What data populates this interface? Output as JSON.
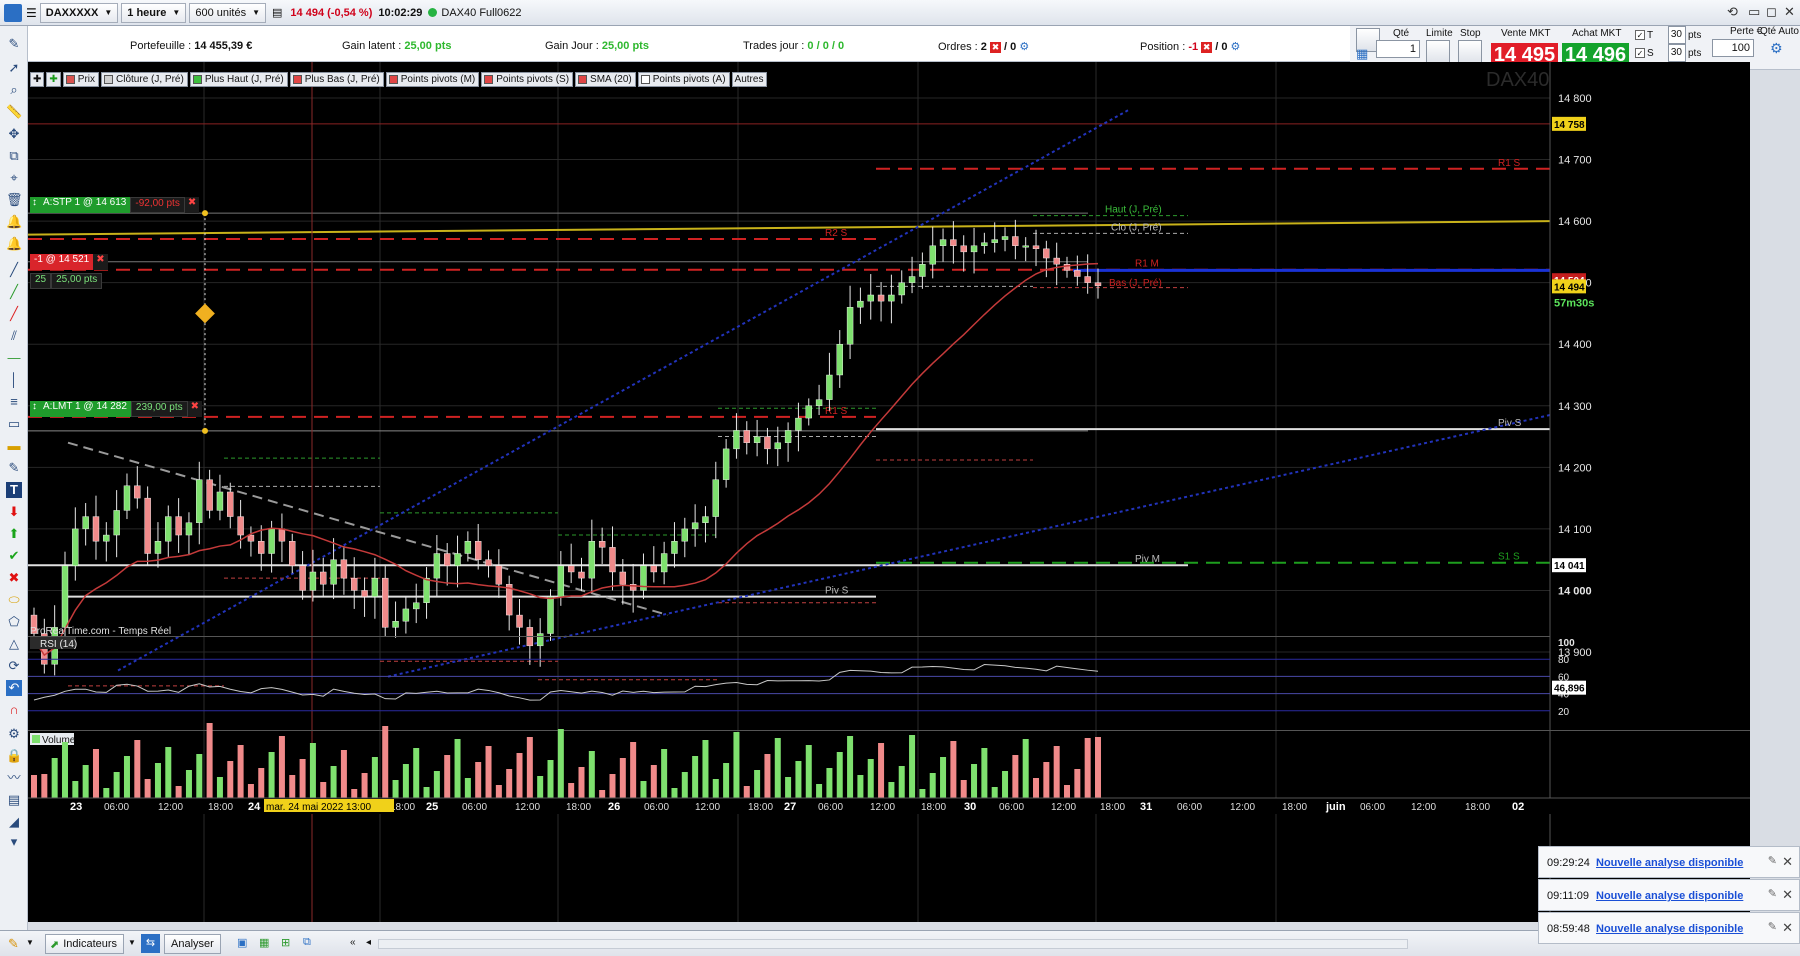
{
  "toolbar": {
    "instrument": "DAXXXXX",
    "timeframe": "1 heure",
    "units": "600 unités",
    "price": "14 494 (-0,54 %)",
    "time": "10:02:29",
    "instrument_name": "DAX40 Full0622"
  },
  "info": {
    "portefeuille_label": "Portefeuille :",
    "portefeuille_value": "14 455,39 €",
    "gain_latent_label": "Gain latent :",
    "gain_latent_value": "25,00 pts",
    "gain_jour_label": "Gain Jour :",
    "gain_jour_value": "25,00 pts",
    "trades_label": "Trades jour :",
    "trades_value": "0 / 0 / 0",
    "ordres_label": "Ordres :",
    "ordres_value": "2",
    "ordres_value2": "/ 0",
    "position_label": "Position :",
    "position_value": "-1",
    "position_value2": "/ 0"
  },
  "order": {
    "qte_label": "Qté",
    "qte_value": "1",
    "limite_label": "Limite",
    "stop_label": "Stop",
    "vente_label": "Vente MKT",
    "vente_price": "14 495",
    "achat_label": "Achat MKT",
    "achat_price": "14 496",
    "t_label": "T",
    "t_value": "30",
    "s_label": "S",
    "s_value": "30",
    "pts": "pts",
    "perte_label": "Perte €",
    "perte_value": "100",
    "qte_auto_label": "Qté Auto"
  },
  "legend": [
    {
      "label": "Prix",
      "color": "#d9534f"
    },
    {
      "label": "Clôture (J, Pré)",
      "color": "#cfcfcf"
    },
    {
      "label": "Plus Haut (J, Pré)",
      "color": "#3fbf3f"
    },
    {
      "label": "Plus Bas (J, Pré)",
      "color": "#e04646"
    },
    {
      "label": "Points pivots (M)",
      "color": "#e04646"
    },
    {
      "label": "Points pivots (S)",
      "color": "#e04646"
    },
    {
      "label": "SMA (20)",
      "color": "#e04646"
    },
    {
      "label": "Points pivots (A)",
      "color": "#ffffff"
    },
    {
      "label": "Autres",
      "color": ""
    }
  ],
  "chart": {
    "watermark": "DAX40 Full0622",
    "source": "ProRealTime.com - Temps Réel",
    "price_ticks": [
      "14 800",
      "14 700",
      "14 600",
      "14 500",
      "14 400",
      "14 300",
      "14 200",
      "14 100",
      "14 000",
      "13 900"
    ],
    "tag_14758": "14 758",
    "tag_14504": "14 504",
    "tag_14494": "14 494",
    "tag_timer": "57m30s",
    "tag_14041": "14 041",
    "orders": {
      "stp_label": "A:STP 1 @ 14 613",
      "stp_pts": "-92,00 pts",
      "pos_label": "-1 @ 14 521",
      "pos_qty": "25",
      "pos_pts": "25,00 pts",
      "lmt_label": "A:LMT 1 @ 14 282",
      "lmt_pts": "239,00 pts"
    },
    "levels": {
      "r2s": "R2 S",
      "r1s": "R1 S",
      "r1m": "R1 M",
      "r1s_top": "R1 S",
      "haut": "Haut (J, Pré)",
      "clo": "Clo (J, Pré)",
      "bas": "Bas (J, Pré)",
      "piv_s_right": "Piv S",
      "piv_s": "Piv S",
      "piv_m": "Piv M",
      "s1s": "S1 S"
    }
  },
  "rsi": {
    "label": "RSI (14)",
    "ticks": [
      "100",
      "80",
      "60",
      "40",
      "20"
    ],
    "value": "46,896"
  },
  "volume": {
    "label": "Volume"
  },
  "xaxis": [
    "23",
    "06:00",
    "12:00",
    "18:00",
    "24",
    "06:00",
    "12:00",
    "18:00",
    "25",
    "06:00",
    "12:00",
    "18:00",
    "26",
    "06:00",
    "12:00",
    "18:00",
    "27",
    "06:00",
    "12:00",
    "18:00",
    "30",
    "06:00",
    "12:00",
    "18:00",
    "31",
    "06:00",
    "12:00",
    "18:00",
    "juin",
    "06:00",
    "12:00",
    "18:00",
    "02"
  ],
  "cursor_date": "mar. 24 mai 2022 13:00",
  "bottom": {
    "indicateurs": "Indicateurs",
    "analyser": "Analyser"
  },
  "notifications": [
    {
      "time": "09:29:24",
      "text": "Nouvelle analyse disponible"
    },
    {
      "time": "09:11:09",
      "text": "Nouvelle analyse disponible"
    },
    {
      "time": "08:59:48",
      "text": "Nouvelle analyse disponible"
    }
  ]
}
